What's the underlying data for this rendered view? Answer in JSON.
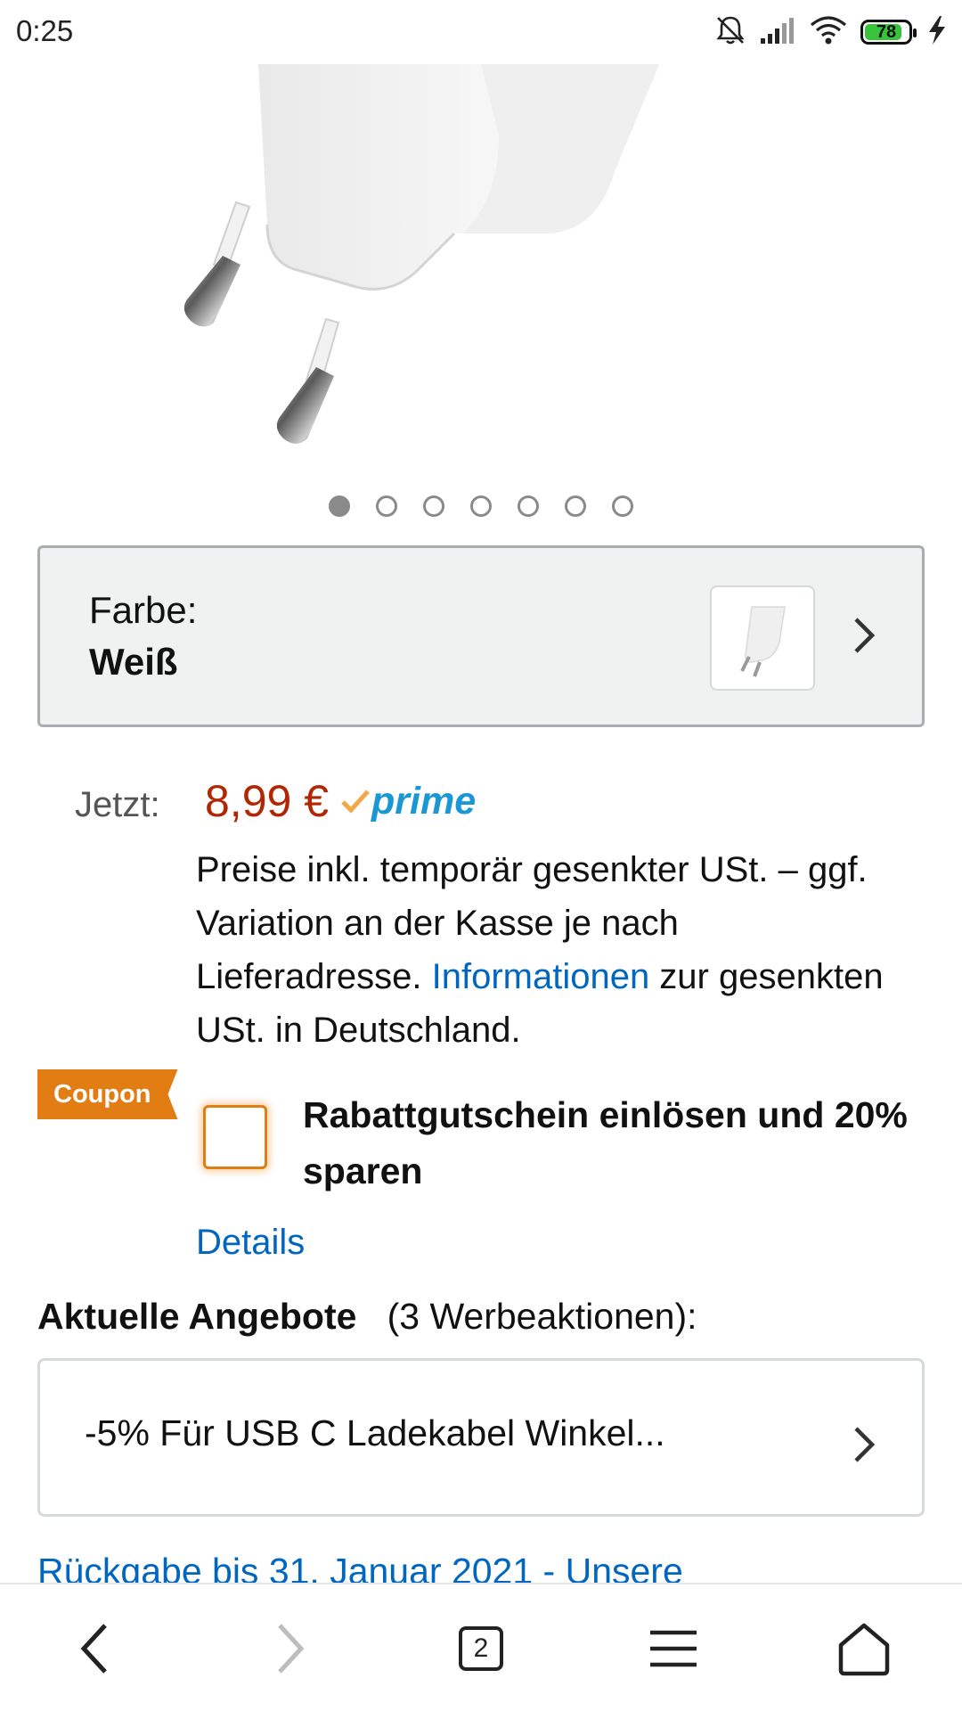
{
  "status_bar": {
    "time": "0:25",
    "battery_level": "78",
    "icons": [
      "bell-off-icon",
      "cellular-signal-icon",
      "wifi-icon",
      "battery-icon",
      "charging-bolt-icon"
    ]
  },
  "product": {
    "image_alt": "white-usb-wall-charger",
    "carousel": {
      "total": 7,
      "active_index": 0
    }
  },
  "color_selector": {
    "label": "Farbe:",
    "value": "Weiß"
  },
  "price": {
    "label": "Jetzt:",
    "value": "8,99 €",
    "prime_label": "prime",
    "price_color": "#b12704",
    "prime_color": "#1a98d5"
  },
  "tax_note": {
    "before_link": "Preise inkl. temporär gesenkter USt. – ggf. Variation an der Kasse je nach Lieferadresse. ",
    "link_text": "Informationen",
    "after_link": " zur gesenkten USt. in Deutschland."
  },
  "coupon": {
    "badge": "Coupon",
    "text": "Rabattgutschein einlösen und 20% sparen",
    "checked": false,
    "details_link": "Details",
    "accent_color": "#e17d13"
  },
  "offers": {
    "heading": "Aktuelle Angebote",
    "count_text": "(3 Werbeaktionen):",
    "first_offer": "-5% Für USB C Ladekabel Winkel..."
  },
  "return_policy": {
    "text": "Rückgabe bis 31. Januar 2021 - Unsere"
  },
  "bottom_nav": {
    "tab_count": "2",
    "items": [
      "back-icon",
      "forward-icon",
      "tabs-icon",
      "menu-icon",
      "home-icon"
    ]
  },
  "colors": {
    "link": "#0066c0"
  }
}
